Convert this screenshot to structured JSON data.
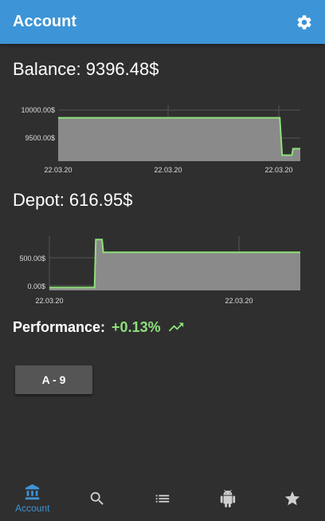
{
  "appbar": {
    "title": "Account",
    "settings_icon": "gear-icon"
  },
  "balance": {
    "label": "Balance: 9396.48$"
  },
  "depot": {
    "label": "Depot: 616.95$"
  },
  "performance": {
    "label": "Performance:",
    "value": "+0.13%",
    "trend_icon": "trending-up-icon",
    "value_color": "#8ee07a"
  },
  "strategy_button": {
    "label": "A - 9"
  },
  "nav": {
    "items": [
      {
        "icon": "bank-icon",
        "label": "Account",
        "active": true
      },
      {
        "icon": "search-icon",
        "label": ""
      },
      {
        "icon": "list-icon",
        "label": ""
      },
      {
        "icon": "android-icon",
        "label": ""
      },
      {
        "icon": "star-icon",
        "label": ""
      }
    ],
    "accent": "#3d94d6"
  },
  "chart_data": [
    {
      "type": "area",
      "title": "",
      "x_tick_labels": [
        "22.03.20",
        "22.03.20",
        "22.03.20"
      ],
      "y_tick_labels": [
        "10000.00$",
        "9500.00$"
      ],
      "ylim": [
        9300,
        10200
      ],
      "x": [
        0,
        0.915,
        0.925,
        0.965,
        0.97,
        1.0
      ],
      "values": [
        10000,
        10000,
        9396,
        9396,
        9500,
        9500
      ],
      "line_color": "#8ee07a",
      "fill_color": "#8a8a8a",
      "grid": true
    },
    {
      "type": "area",
      "title": "",
      "x_tick_labels": [
        "22.03.20",
        "22.03.20"
      ],
      "y_tick_labels": [
        "500.00$",
        "0.00$"
      ],
      "ylim": [
        -50,
        900
      ],
      "x": [
        0,
        0.18,
        0.185,
        0.21,
        0.215,
        1.0
      ],
      "values": [
        0,
        0,
        840,
        840,
        616.95,
        616.95
      ],
      "line_color": "#8ee07a",
      "fill_color": "#8a8a8a",
      "grid": true
    }
  ]
}
